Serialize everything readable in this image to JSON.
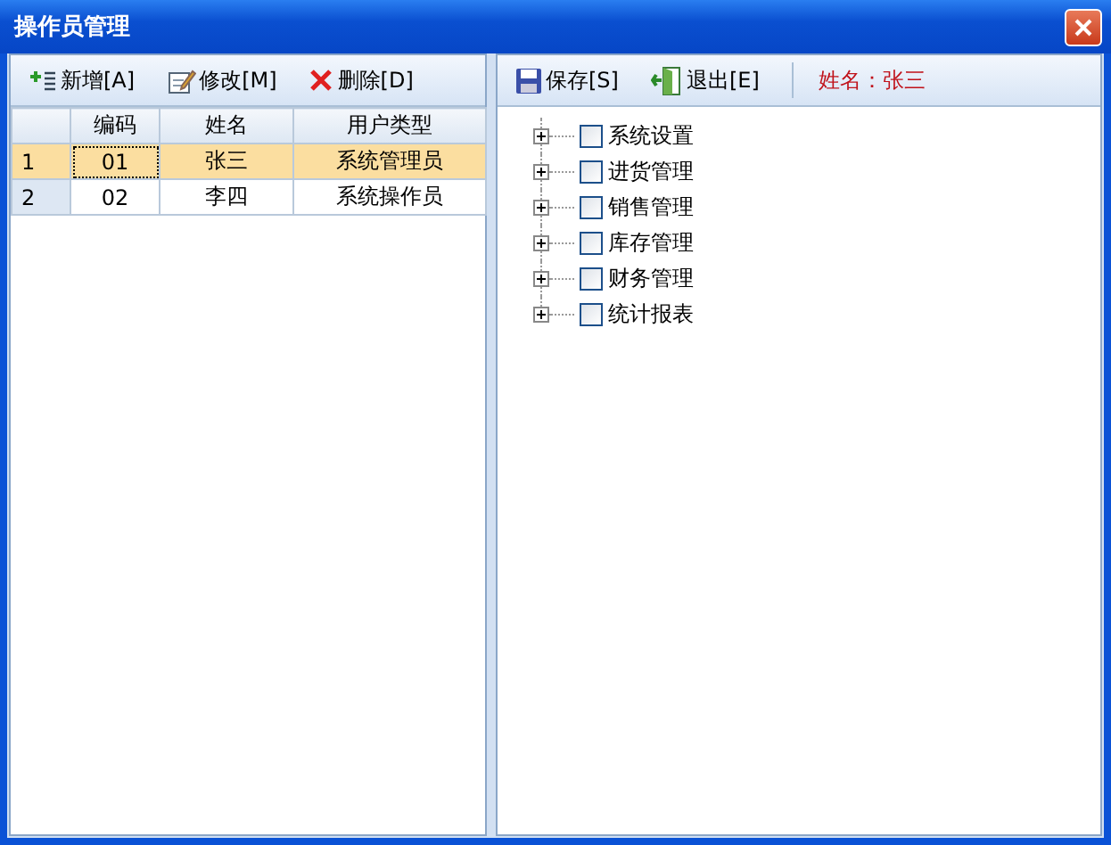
{
  "window": {
    "title": "操作员管理"
  },
  "left_toolbar": [
    {
      "kind": "add",
      "label": "新增[A]"
    },
    {
      "kind": "edit",
      "label": "修改[M]"
    },
    {
      "kind": "delete",
      "label": "删除[D]"
    }
  ],
  "right_toolbar": [
    {
      "kind": "save",
      "label": "保存[S]"
    },
    {
      "kind": "exit",
      "label": "退出[E]"
    }
  ],
  "current_user": "姓名：张三",
  "table": {
    "columns": [
      "编码",
      "姓名",
      "用户类型"
    ],
    "rows": [
      {
        "index": "1",
        "cells": [
          "01",
          "张三",
          "系统管理员"
        ],
        "selected": true
      },
      {
        "index": "2",
        "cells": [
          "02",
          "李四",
          "系统操作员"
        ],
        "selected": false
      }
    ]
  },
  "tree": [
    {
      "label": "系统设置",
      "expanded": false,
      "checked": false
    },
    {
      "label": "进货管理",
      "expanded": false,
      "checked": false
    },
    {
      "label": "销售管理",
      "expanded": false,
      "checked": false
    },
    {
      "label": "库存管理",
      "expanded": false,
      "checked": false
    },
    {
      "label": "财务管理",
      "expanded": false,
      "checked": false
    },
    {
      "label": "统计报表",
      "expanded": false,
      "checked": false
    }
  ]
}
